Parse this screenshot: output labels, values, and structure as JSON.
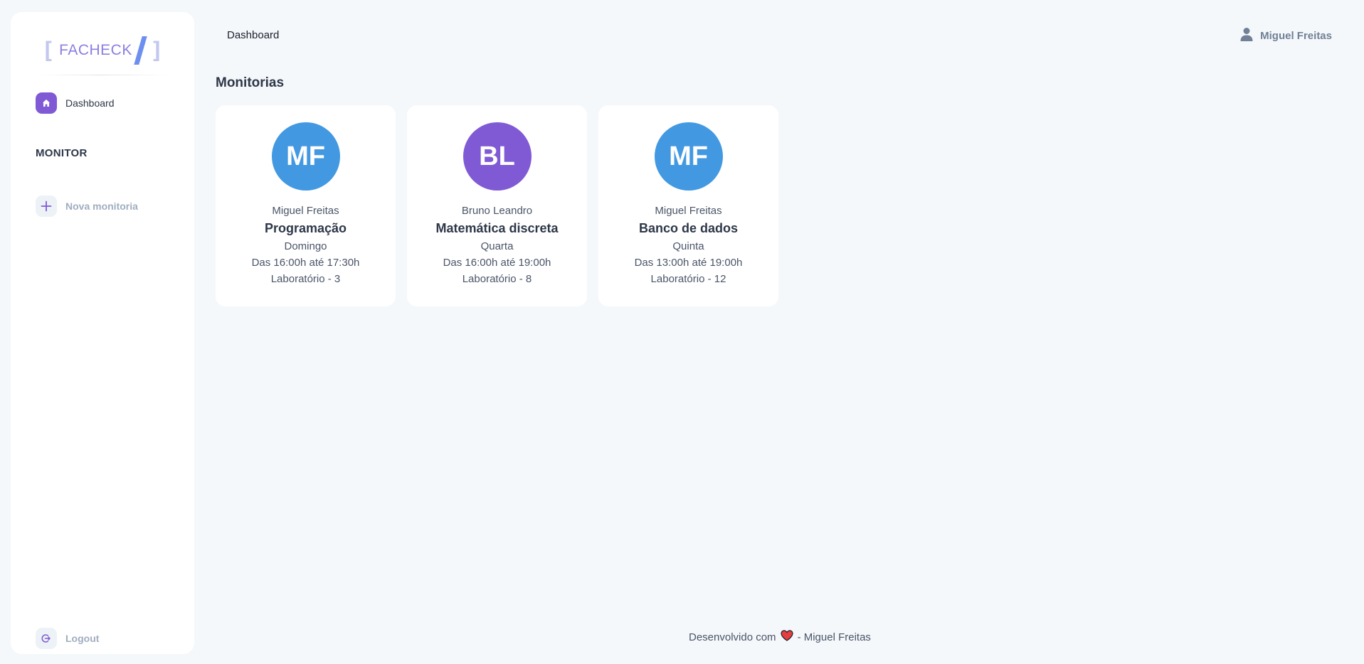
{
  "brand": {
    "bracket_left": "[",
    "name": "FACHECK",
    "bracket_right": "]",
    "accent_color": "#8b7fe0"
  },
  "sidebar": {
    "items": [
      {
        "label": "Dashboard",
        "icon": "home-icon"
      }
    ],
    "section_title": "MONITOR",
    "section_items": [
      {
        "label": "Nova monitoria",
        "icon": "plus-icon"
      }
    ],
    "logout_label": "Logout"
  },
  "header": {
    "title": "Dashboard",
    "user_name": "Miguel Freitas"
  },
  "main": {
    "heading": "Monitorias",
    "cards": [
      {
        "initials": "MF",
        "avatar_color": "#4299e1",
        "monitor": "Miguel Freitas",
        "subject": "Programação",
        "day": "Domingo",
        "time": "Das 16:00h até 17:30h",
        "room": "Laboratório - 3"
      },
      {
        "initials": "BL",
        "avatar_color": "#805ad5",
        "monitor": "Bruno Leandro",
        "subject": "Matemática discreta",
        "day": "Quarta",
        "time": "Das 16:00h até 19:00h",
        "room": "Laboratório - 8"
      },
      {
        "initials": "MF",
        "avatar_color": "#4299e1",
        "monitor": "Miguel Freitas",
        "subject": "Banco de dados",
        "day": "Quinta",
        "time": "Das 13:00h até 19:00h",
        "room": "Laboratório - 12"
      }
    ]
  },
  "footer": {
    "prefix": "Desenvolvido com",
    "suffix": "- Miguel Freitas",
    "heart_color": "#e53e3e"
  }
}
